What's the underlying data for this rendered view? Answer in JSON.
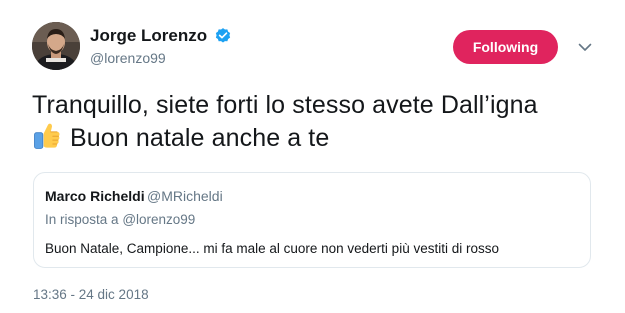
{
  "author": {
    "name": "Jorge Lorenzo",
    "handle": "@lorenzo99",
    "verified": true
  },
  "follow_button": {
    "label": "Following",
    "color": "#e0245e"
  },
  "menu": {
    "icon": "chevron-down-icon"
  },
  "tweet": {
    "line1": "Tranquillo, siete forti lo stesso avete Dall’igna",
    "line2": "Buon natale anche a te",
    "emoji": "thumbs-up-icon"
  },
  "quoted_tweet": {
    "author_name": "Marco Richeldi",
    "author_handle": "@MRicheldi",
    "reply_prefix": "In risposta a",
    "reply_to": "@lorenzo99",
    "text": "Buon Natale, Campione... mi fa male al cuore non vederti più vestiti di rosso"
  },
  "timestamp": "13:36 - 24 dic 2018",
  "colors": {
    "accent": "#e0245e",
    "verified": "#1da1f2",
    "secondary_text": "#657786",
    "border": "#e1e8ed"
  }
}
